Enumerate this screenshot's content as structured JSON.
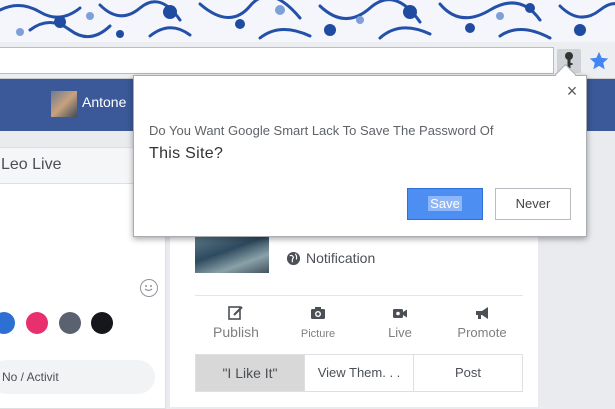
{
  "browser": {
    "key_icon": "key-icon",
    "star_icon": "bookmark-star-icon"
  },
  "facebook": {
    "profile_name": "Antone",
    "composer": {
      "title": "Leo Live",
      "activity_label": "No / Activit",
      "swatch_colors": [
        "#2d6fd2",
        "#e8306f",
        "#5a6270",
        "#15171a"
      ]
    },
    "page": {
      "notification_label": "Notification",
      "actions": [
        {
          "label": "Publish",
          "icon": "edit-icon"
        },
        {
          "label": "Picture",
          "icon": "camera-icon"
        },
        {
          "label": "Live",
          "icon": "video-icon"
        },
        {
          "label": "Promote",
          "icon": "megaphone-icon"
        }
      ],
      "tabs": [
        "\"I Like It\"",
        "View Them. . .",
        "Post"
      ]
    }
  },
  "dialog": {
    "line1": "Do You Want Google Smart Lack To Save The Password Of",
    "line2": "This Site?",
    "save_label": "Save",
    "never_label": "Never",
    "close_symbol": "×"
  }
}
